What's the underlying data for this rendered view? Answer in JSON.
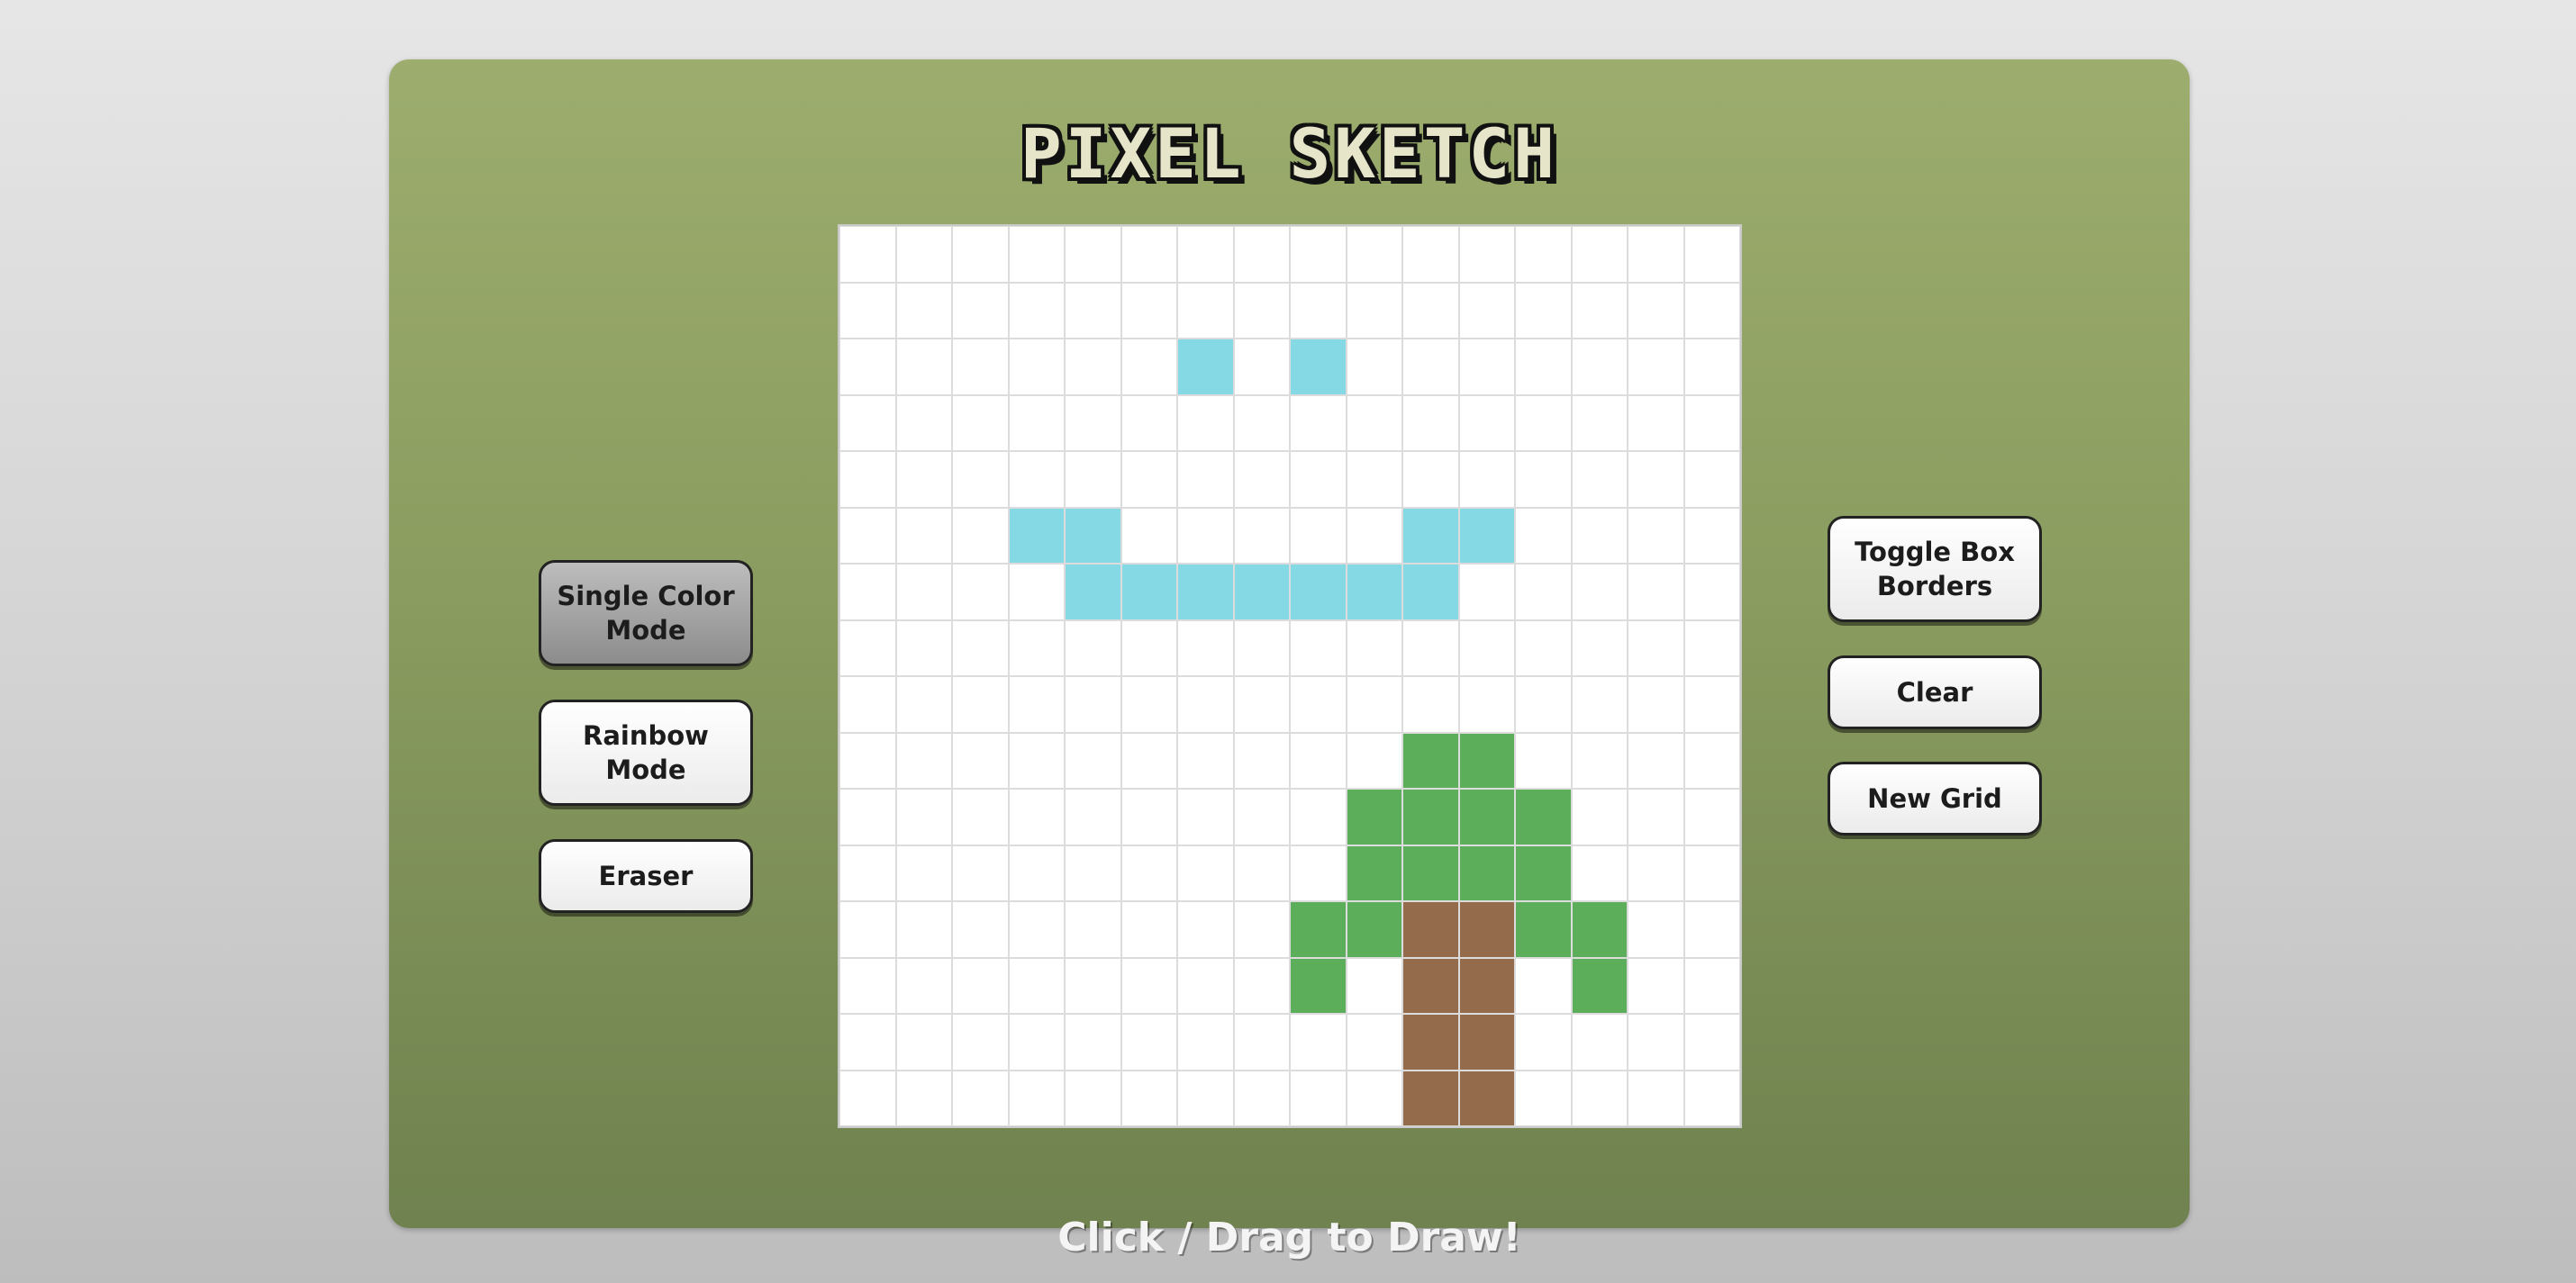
{
  "app": {
    "title": "PIXEL SKETCH",
    "instruction": "Click / Drag to Draw!"
  },
  "current_color": "#85d9e5",
  "controls_left": {
    "single_color_label": "Single Color Mode",
    "rainbow_label": "Rainbow Mode",
    "eraser_label": "Eraser",
    "active_mode": "single-color"
  },
  "controls_right": {
    "toggle_borders_label": "Toggle Box Borders",
    "clear_label": "Clear",
    "new_grid_label": "New Grid"
  },
  "palette": {
    "B": "#85d9e5",
    "G": "#5cae5b",
    "T": "#946b4b",
    "empty": "#ffffff"
  },
  "grid": {
    "size": 16,
    "rows": [
      "................",
      "................",
      "......B.B.......",
      "................",
      "................",
      "...BB.....BB....",
      "....BBBBBBB.....",
      "................",
      "................",
      "..........GG....",
      ".........GGGG...",
      ".........GGGG...",
      "........GGTTGG..",
      "........G.TT.G..",
      "..........TT....",
      "..........TT...."
    ]
  }
}
